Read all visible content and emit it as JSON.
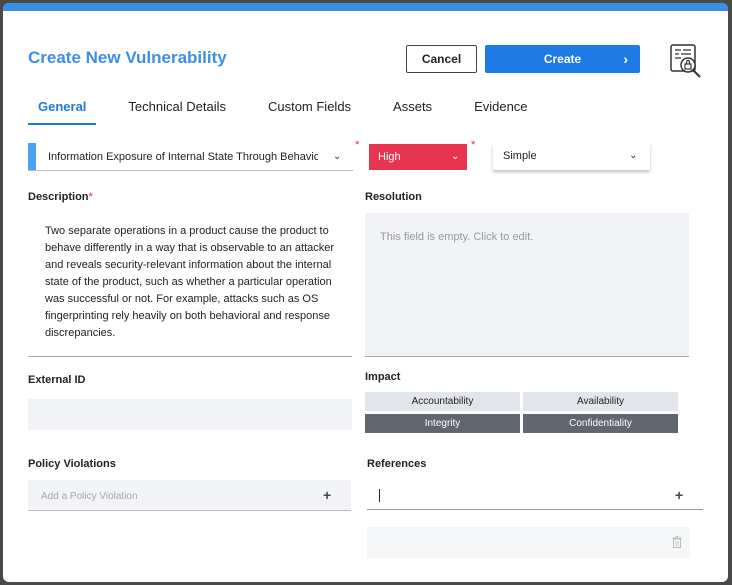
{
  "modal": {
    "title": "Create New Vulnerability",
    "cancel_label": "Cancel",
    "create_label": "Create",
    "accent": "#1e7be6"
  },
  "tabs": [
    {
      "label": "General",
      "active": true
    },
    {
      "label": "Technical Details",
      "active": false
    },
    {
      "label": "Custom Fields",
      "active": false
    },
    {
      "label": "Assets",
      "active": false
    },
    {
      "label": "Evidence",
      "active": false
    }
  ],
  "fields": {
    "cwe_value": "Information Exposure of Internal State Through Behavioral Inconsistency",
    "severity_value": "High",
    "severity_color": "#e8354f",
    "type_value": "Simple",
    "required_mark": "*",
    "description_label": "Description",
    "description_value": "Two separate operations in a product cause the product to behave differently in a way that is observable to an attacker and reveals security-relevant information about the internal state of the product, such as whether a particular operation was successful or not. For example, attacks such as OS fingerprinting rely heavily on both behavioral and response discrepancies.",
    "resolution_label": "Resolution",
    "resolution_placeholder": "This field is empty. Click to edit.",
    "external_id_label": "External ID",
    "external_id_value": "",
    "impact_label": "Impact",
    "impact": [
      {
        "label": "Accountability",
        "selected": false
      },
      {
        "label": "Availability",
        "selected": false
      },
      {
        "label": "Integrity",
        "selected": true
      },
      {
        "label": "Confidentiality",
        "selected": true
      }
    ],
    "policy_label": "Policy Violations",
    "policy_placeholder": "Add a Policy Violation",
    "references_label": "References",
    "references_value": ""
  },
  "icons": {
    "create_chevron": "chevron-right-icon",
    "dropdown": "chevron-down-icon",
    "add": "plus-icon",
    "delete": "trash-icon",
    "header": "vulnerability-search-icon"
  }
}
